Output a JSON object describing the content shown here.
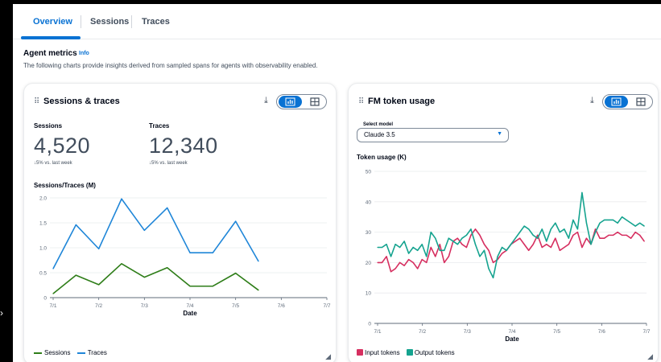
{
  "tabs": [
    {
      "label": "Overview",
      "active": true
    },
    {
      "label": "Sessions",
      "active": false
    },
    {
      "label": "Traces",
      "active": false
    }
  ],
  "section": {
    "title": "Agent metrics",
    "info_label": "Info",
    "description": "The following charts provide insights derived from sampled spans for agents with observability enabled."
  },
  "sessions_card": {
    "title": "Sessions & traces",
    "kpis": [
      {
        "label": "Sessions",
        "value": "4,520",
        "delta": "5% vs. last week"
      },
      {
        "label": "Traces",
        "value": "12,340",
        "delta": "5% vs. last week"
      }
    ],
    "view_toggle": {
      "selected": "chart-icon",
      "other": "table-icon"
    }
  },
  "token_card": {
    "title": "FM token usage",
    "select_label": "Select model",
    "select_value": "Claude 3.5",
    "view_toggle": {
      "selected": "chart-icon",
      "other": "table-icon"
    }
  },
  "colors": {
    "accent": "#0972d3",
    "sessions": "#2e7d18",
    "traces": "#1f86d8",
    "input_tokens": "#d62f60",
    "output_tokens": "#15a38f"
  },
  "chart_data": [
    {
      "type": "line",
      "ylabel": "Sessions/Traces (M)",
      "xlabel": "Date",
      "x": [
        0,
        0.5,
        1,
        1.5,
        2,
        2.5,
        3,
        3.5,
        4,
        4.5,
        5,
        5.5,
        6
      ],
      "x_ticks": [
        "7/1",
        "7/2",
        "7/3",
        "7/4",
        "7/5",
        "7/6",
        "7/7"
      ],
      "y_ticks": [
        "0",
        "0.5",
        "1.0",
        "1.5",
        "2.0"
      ],
      "ylim": [
        0,
        2.0
      ],
      "grid": true,
      "legend": "bottom-left",
      "series": [
        {
          "name": "Sessions",
          "values": [
            0.08,
            0.45,
            0.26,
            0.68,
            0.41,
            0.6,
            0.23,
            0.23,
            0.49,
            0.15
          ]
        },
        {
          "name": "Traces",
          "values": [
            0.58,
            1.46,
            0.98,
            1.98,
            1.35,
            1.8,
            0.9,
            0.9,
            1.53,
            0.73
          ]
        }
      ],
      "point_x": [
        0,
        0.5,
        1,
        1.5,
        2,
        2.5,
        3,
        3.5,
        4,
        4.5
      ],
      "x_end": 4.5
    },
    {
      "type": "line",
      "ylabel": "Token usage (K)",
      "xlabel": "Date",
      "x_ticks": [
        "7/1",
        "7/2",
        "7/3",
        "7/4",
        "7/5",
        "7/6",
        "7/7"
      ],
      "y_ticks": [
        "0",
        "10",
        "20",
        "30",
        "40",
        "50"
      ],
      "ylim": [
        0,
        50
      ],
      "grid": true,
      "legend": "bottom-left",
      "x_end": 5.95,
      "series": [
        {
          "name": "Input tokens",
          "values": [
            20,
            20,
            22,
            17,
            18,
            20,
            19,
            21,
            20,
            18,
            21,
            20,
            25,
            22,
            26,
            20,
            22,
            27,
            28,
            26,
            25,
            29,
            31,
            29,
            26,
            24,
            20,
            21,
            23,
            24,
            26,
            27,
            28,
            26,
            24,
            26,
            29,
            25,
            26,
            25,
            28,
            24,
            25,
            26,
            29,
            30,
            25,
            28,
            26,
            31,
            28,
            28,
            29,
            29,
            30,
            29,
            29,
            28,
            30,
            29,
            27
          ]
        },
        {
          "name": "Output tokens",
          "values": [
            25,
            25,
            26,
            22,
            26,
            25,
            27,
            23,
            25,
            24,
            26,
            22,
            30,
            28,
            24,
            24,
            28,
            27,
            26,
            28,
            29,
            31,
            26,
            22,
            24,
            18,
            15,
            22,
            25,
            24,
            26,
            28,
            30,
            32,
            31,
            29,
            28,
            31,
            27,
            31,
            33,
            30,
            31,
            28,
            34,
            31,
            43,
            33,
            26,
            30,
            33,
            34,
            34,
            34,
            33,
            35,
            34,
            33,
            32,
            33,
            32
          ]
        }
      ]
    }
  ]
}
